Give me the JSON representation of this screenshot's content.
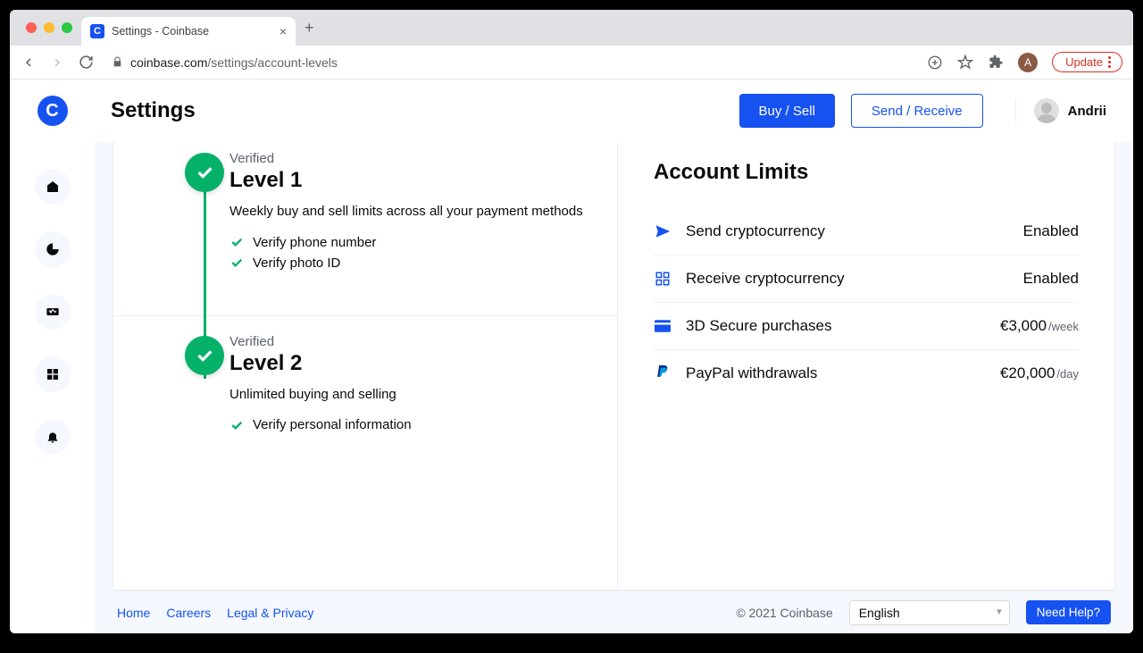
{
  "browser": {
    "tab_title": "Settings - Coinbase",
    "url_domain": "coinbase.com",
    "url_path": "/settings/account-levels",
    "update_label": "Update",
    "avatar_letter": "A"
  },
  "header": {
    "page_title": "Settings",
    "buy_sell": "Buy / Sell",
    "send_receive": "Send / Receive",
    "username": "Andrii"
  },
  "levels": [
    {
      "status": "Verified",
      "title": "Level 1",
      "desc": "Weekly buy and sell limits across all your payment methods",
      "tasks": [
        "Verify phone number",
        "Verify photo ID"
      ]
    },
    {
      "status": "Verified",
      "title": "Level 2",
      "desc": "Unlimited buying and selling",
      "tasks": [
        "Verify personal information"
      ]
    }
  ],
  "limits": {
    "title": "Account Limits",
    "rows": [
      {
        "label": "Send cryptocurrency",
        "value": "Enabled",
        "unit": ""
      },
      {
        "label": "Receive cryptocurrency",
        "value": "Enabled",
        "unit": ""
      },
      {
        "label": "3D Secure purchases",
        "value": "€3,000",
        "unit": "/week"
      },
      {
        "label": "PayPal withdrawals",
        "value": "€20,000",
        "unit": "/day"
      }
    ]
  },
  "footer": {
    "home": "Home",
    "careers": "Careers",
    "legal": "Legal & Privacy",
    "copyright": "© 2021 Coinbase",
    "language": "English",
    "help": "Need Help?"
  }
}
